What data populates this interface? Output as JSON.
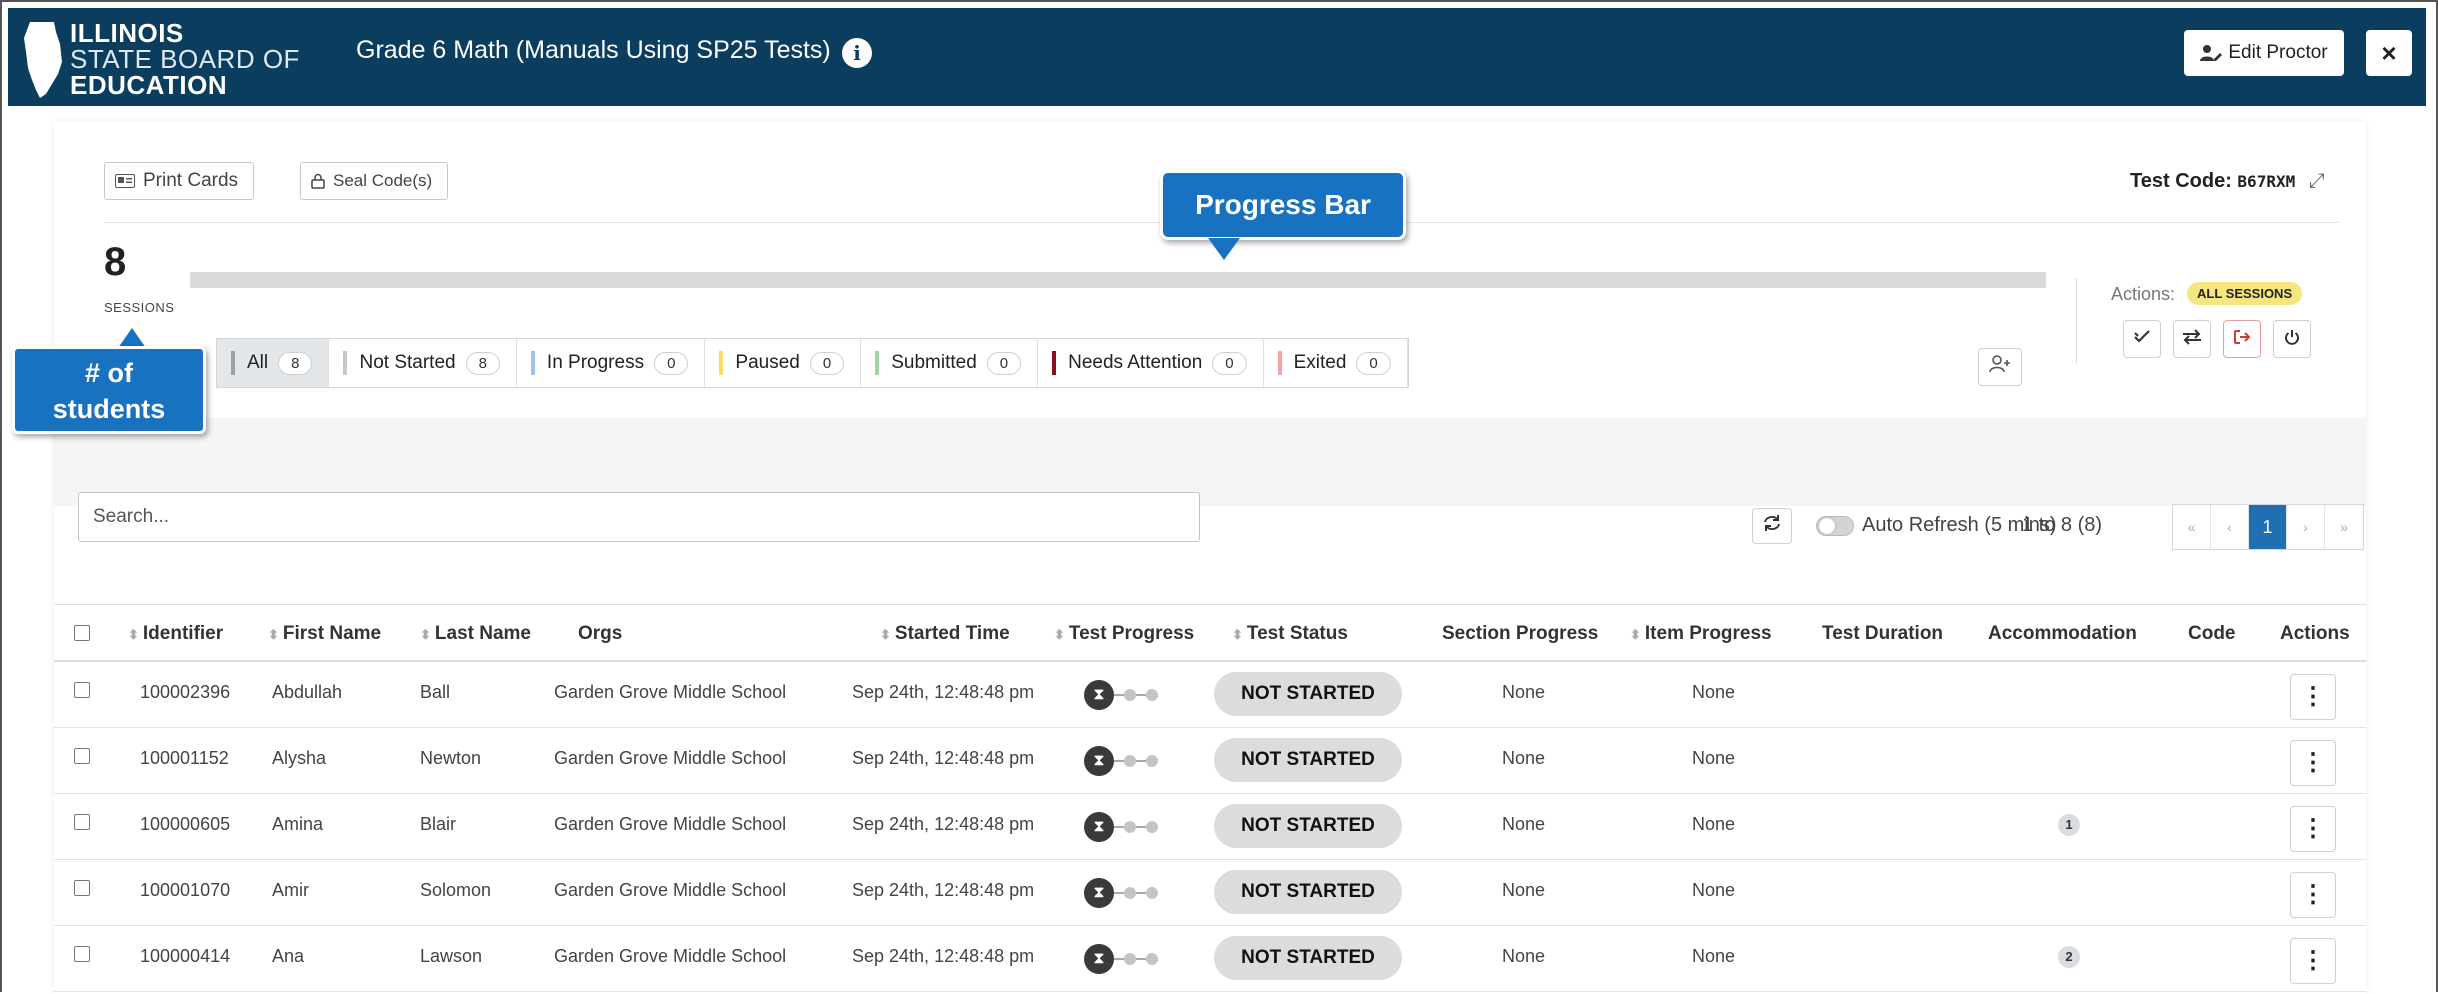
{
  "header": {
    "logo_line1": "ILLINOIS",
    "logo_line2": "STATE BOARD OF",
    "logo_line3": "EDUCATION",
    "title": "Grade 6 Math (Manuals Using SP25 Tests)",
    "info_icon": "i",
    "edit_proctor_label": "Edit Proctor",
    "close_label": "×"
  },
  "toolbar": {
    "print_cards_label": "Print Cards",
    "seal_code_label": "Seal Code(s)",
    "test_code_label": "Test Code:",
    "test_code_value": "B67RXM",
    "expand_icon": "⤢"
  },
  "sessions": {
    "count": "8",
    "label": "SESSIONS",
    "progress_fraction": 0
  },
  "actions": {
    "label": "Actions:",
    "scope_badge": "ALL SESSIONS",
    "buttons": [
      "double-check-icon",
      "swap-icon",
      "exit-icon",
      "power-icon"
    ]
  },
  "filters": [
    {
      "label": "All",
      "count": "8",
      "color": "#9aa3ab"
    },
    {
      "label": "Not Started",
      "count": "8",
      "color": "#c8c8c8"
    },
    {
      "label": "In Progress",
      "count": "0",
      "color": "#9cc3ea"
    },
    {
      "label": "Paused",
      "count": "0",
      "color": "#f6dc6b"
    },
    {
      "label": "Submitted",
      "count": "0",
      "color": "#9fd4a3"
    },
    {
      "label": "Needs Attention",
      "count": "0",
      "color": "#8b0f22"
    },
    {
      "label": "Exited",
      "count": "0",
      "color": "#f0a5a5"
    }
  ],
  "search": {
    "placeholder": "Search..."
  },
  "refresh": {
    "auto_refresh_label": "Auto Refresh (5 mins)",
    "auto_refresh_on": false
  },
  "pagination": {
    "range": "1 to 8 (8)",
    "first": "«",
    "prev": "‹",
    "current": "1",
    "next": "›",
    "last": "»"
  },
  "table": {
    "columns": [
      "Identifier",
      "First Name",
      "Last Name",
      "Orgs",
      "Started Time",
      "Test Progress",
      "Test Status",
      "Section Progress",
      "Item Progress",
      "Test Duration",
      "Accommodation",
      "Code",
      "Actions"
    ],
    "rows": [
      {
        "id": "100002396",
        "first": "Abdullah",
        "last": "Ball",
        "org": "Garden Grove Middle School",
        "started": "Sep 24th, 12:48:48 pm",
        "status": "NOT STARTED",
        "section": "None",
        "item": "None",
        "duration": "",
        "accommodation": "",
        "code": ""
      },
      {
        "id": "100001152",
        "first": "Alysha",
        "last": "Newton",
        "org": "Garden Grove Middle School",
        "started": "Sep 24th, 12:48:48 pm",
        "status": "NOT STARTED",
        "section": "None",
        "item": "None",
        "duration": "",
        "accommodation": "",
        "code": ""
      },
      {
        "id": "100000605",
        "first": "Amina",
        "last": "Blair",
        "org": "Garden Grove Middle School",
        "started": "Sep 24th, 12:48:48 pm",
        "status": "NOT STARTED",
        "section": "None",
        "item": "None",
        "duration": "",
        "accommodation": "1",
        "code": ""
      },
      {
        "id": "100001070",
        "first": "Amir",
        "last": "Solomon",
        "org": "Garden Grove Middle School",
        "started": "Sep 24th, 12:48:48 pm",
        "status": "NOT STARTED",
        "section": "None",
        "item": "None",
        "duration": "",
        "accommodation": "",
        "code": ""
      },
      {
        "id": "100000414",
        "first": "Ana",
        "last": "Lawson",
        "org": "Garden Grove Middle School",
        "started": "Sep 24th, 12:48:48 pm",
        "status": "NOT STARTED",
        "section": "None",
        "item": "None",
        "duration": "",
        "accommodation": "2",
        "code": ""
      }
    ]
  },
  "callouts": {
    "progress_bar": "Progress Bar",
    "students_line1": "# of",
    "students_line2": "students"
  },
  "colors": {
    "header_bg": "#0b3d5e",
    "callout_bg": "#1872c0",
    "pager_active": "#1f6fb2",
    "badge_yellow": "#f7e57d"
  }
}
